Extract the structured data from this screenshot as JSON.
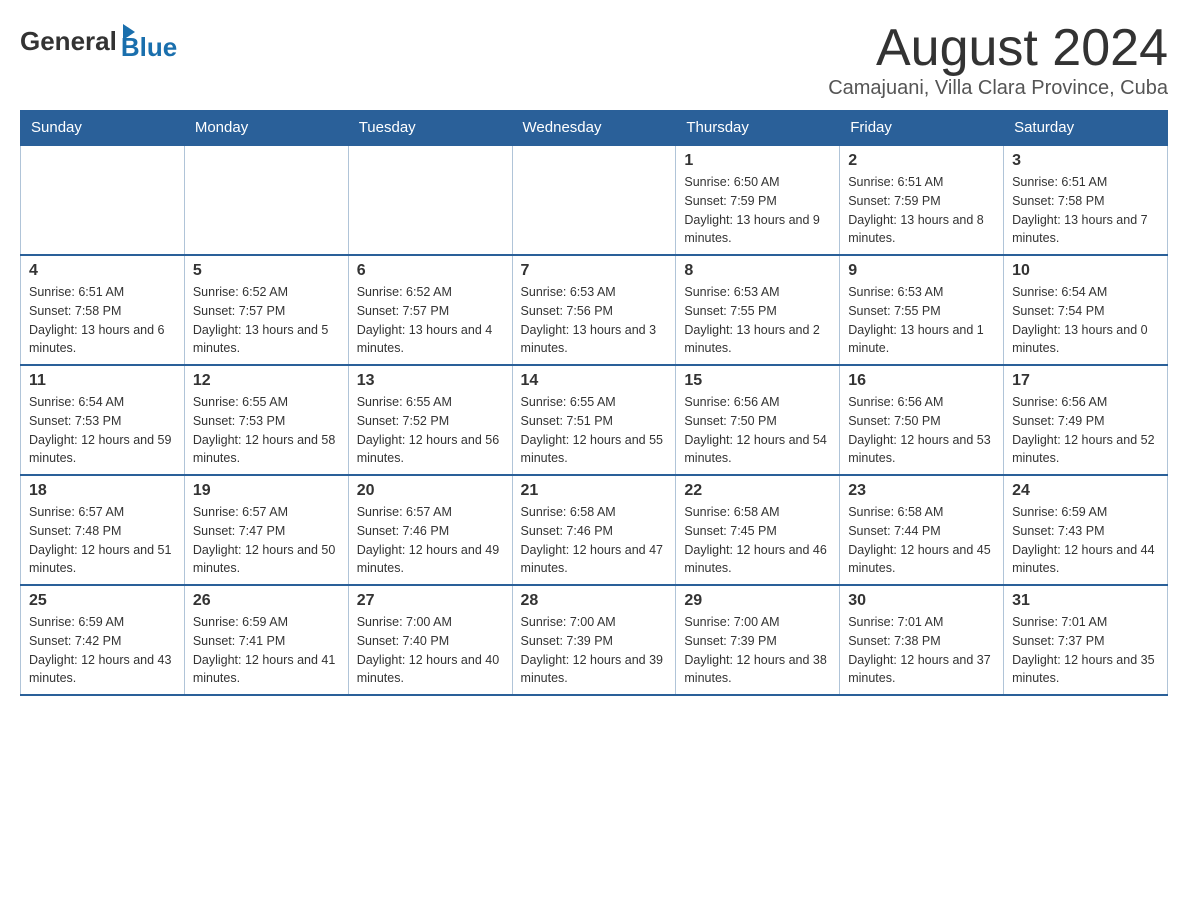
{
  "header": {
    "logo": {
      "general": "General",
      "blue": "Blue"
    },
    "title": "August 2024",
    "location": "Camajuani, Villa Clara Province, Cuba"
  },
  "weekdays": [
    "Sunday",
    "Monday",
    "Tuesday",
    "Wednesday",
    "Thursday",
    "Friday",
    "Saturday"
  ],
  "weeks": [
    [
      {
        "day": "",
        "info": ""
      },
      {
        "day": "",
        "info": ""
      },
      {
        "day": "",
        "info": ""
      },
      {
        "day": "",
        "info": ""
      },
      {
        "day": "1",
        "info": "Sunrise: 6:50 AM\nSunset: 7:59 PM\nDaylight: 13 hours and 9 minutes."
      },
      {
        "day": "2",
        "info": "Sunrise: 6:51 AM\nSunset: 7:59 PM\nDaylight: 13 hours and 8 minutes."
      },
      {
        "day": "3",
        "info": "Sunrise: 6:51 AM\nSunset: 7:58 PM\nDaylight: 13 hours and 7 minutes."
      }
    ],
    [
      {
        "day": "4",
        "info": "Sunrise: 6:51 AM\nSunset: 7:58 PM\nDaylight: 13 hours and 6 minutes."
      },
      {
        "day": "5",
        "info": "Sunrise: 6:52 AM\nSunset: 7:57 PM\nDaylight: 13 hours and 5 minutes."
      },
      {
        "day": "6",
        "info": "Sunrise: 6:52 AM\nSunset: 7:57 PM\nDaylight: 13 hours and 4 minutes."
      },
      {
        "day": "7",
        "info": "Sunrise: 6:53 AM\nSunset: 7:56 PM\nDaylight: 13 hours and 3 minutes."
      },
      {
        "day": "8",
        "info": "Sunrise: 6:53 AM\nSunset: 7:55 PM\nDaylight: 13 hours and 2 minutes."
      },
      {
        "day": "9",
        "info": "Sunrise: 6:53 AM\nSunset: 7:55 PM\nDaylight: 13 hours and 1 minute."
      },
      {
        "day": "10",
        "info": "Sunrise: 6:54 AM\nSunset: 7:54 PM\nDaylight: 13 hours and 0 minutes."
      }
    ],
    [
      {
        "day": "11",
        "info": "Sunrise: 6:54 AM\nSunset: 7:53 PM\nDaylight: 12 hours and 59 minutes."
      },
      {
        "day": "12",
        "info": "Sunrise: 6:55 AM\nSunset: 7:53 PM\nDaylight: 12 hours and 58 minutes."
      },
      {
        "day": "13",
        "info": "Sunrise: 6:55 AM\nSunset: 7:52 PM\nDaylight: 12 hours and 56 minutes."
      },
      {
        "day": "14",
        "info": "Sunrise: 6:55 AM\nSunset: 7:51 PM\nDaylight: 12 hours and 55 minutes."
      },
      {
        "day": "15",
        "info": "Sunrise: 6:56 AM\nSunset: 7:50 PM\nDaylight: 12 hours and 54 minutes."
      },
      {
        "day": "16",
        "info": "Sunrise: 6:56 AM\nSunset: 7:50 PM\nDaylight: 12 hours and 53 minutes."
      },
      {
        "day": "17",
        "info": "Sunrise: 6:56 AM\nSunset: 7:49 PM\nDaylight: 12 hours and 52 minutes."
      }
    ],
    [
      {
        "day": "18",
        "info": "Sunrise: 6:57 AM\nSunset: 7:48 PM\nDaylight: 12 hours and 51 minutes."
      },
      {
        "day": "19",
        "info": "Sunrise: 6:57 AM\nSunset: 7:47 PM\nDaylight: 12 hours and 50 minutes."
      },
      {
        "day": "20",
        "info": "Sunrise: 6:57 AM\nSunset: 7:46 PM\nDaylight: 12 hours and 49 minutes."
      },
      {
        "day": "21",
        "info": "Sunrise: 6:58 AM\nSunset: 7:46 PM\nDaylight: 12 hours and 47 minutes."
      },
      {
        "day": "22",
        "info": "Sunrise: 6:58 AM\nSunset: 7:45 PM\nDaylight: 12 hours and 46 minutes."
      },
      {
        "day": "23",
        "info": "Sunrise: 6:58 AM\nSunset: 7:44 PM\nDaylight: 12 hours and 45 minutes."
      },
      {
        "day": "24",
        "info": "Sunrise: 6:59 AM\nSunset: 7:43 PM\nDaylight: 12 hours and 44 minutes."
      }
    ],
    [
      {
        "day": "25",
        "info": "Sunrise: 6:59 AM\nSunset: 7:42 PM\nDaylight: 12 hours and 43 minutes."
      },
      {
        "day": "26",
        "info": "Sunrise: 6:59 AM\nSunset: 7:41 PM\nDaylight: 12 hours and 41 minutes."
      },
      {
        "day": "27",
        "info": "Sunrise: 7:00 AM\nSunset: 7:40 PM\nDaylight: 12 hours and 40 minutes."
      },
      {
        "day": "28",
        "info": "Sunrise: 7:00 AM\nSunset: 7:39 PM\nDaylight: 12 hours and 39 minutes."
      },
      {
        "day": "29",
        "info": "Sunrise: 7:00 AM\nSunset: 7:39 PM\nDaylight: 12 hours and 38 minutes."
      },
      {
        "day": "30",
        "info": "Sunrise: 7:01 AM\nSunset: 7:38 PM\nDaylight: 12 hours and 37 minutes."
      },
      {
        "day": "31",
        "info": "Sunrise: 7:01 AM\nSunset: 7:37 PM\nDaylight: 12 hours and 35 minutes."
      }
    ]
  ]
}
